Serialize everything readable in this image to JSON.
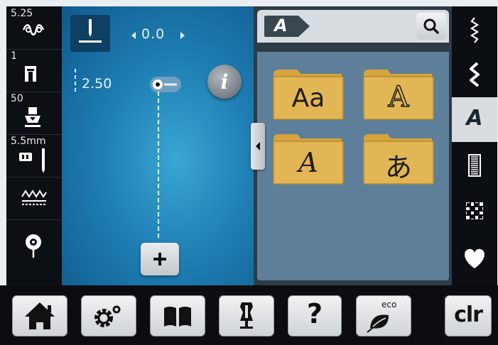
{
  "left_bar": {
    "upper_thread_tension": "5.25",
    "presser_foot": "1",
    "presser_foot_pressure": "50",
    "throat_plate": "5.5mm"
  },
  "main": {
    "needle_position_value": "0.0",
    "stitch_length": "2.50",
    "add_label": "+"
  },
  "panel": {
    "mode_letter": "A",
    "folders": [
      {
        "label": "Aa",
        "name": "text-block-font"
      },
      {
        "label": "A",
        "name": "outline-font"
      },
      {
        "label": "A",
        "name": "script-font"
      },
      {
        "label": "あ",
        "name": "japanese-font"
      }
    ]
  },
  "right_bar": {
    "active_label": "A"
  },
  "bottom_bar": {
    "help_label": "?",
    "eco_label": "eco",
    "clear_label": "clr"
  },
  "colors": {
    "main_blue": "#1f7fb4",
    "folder_gold": "#e3b655",
    "heart_white": "#ffffff"
  }
}
